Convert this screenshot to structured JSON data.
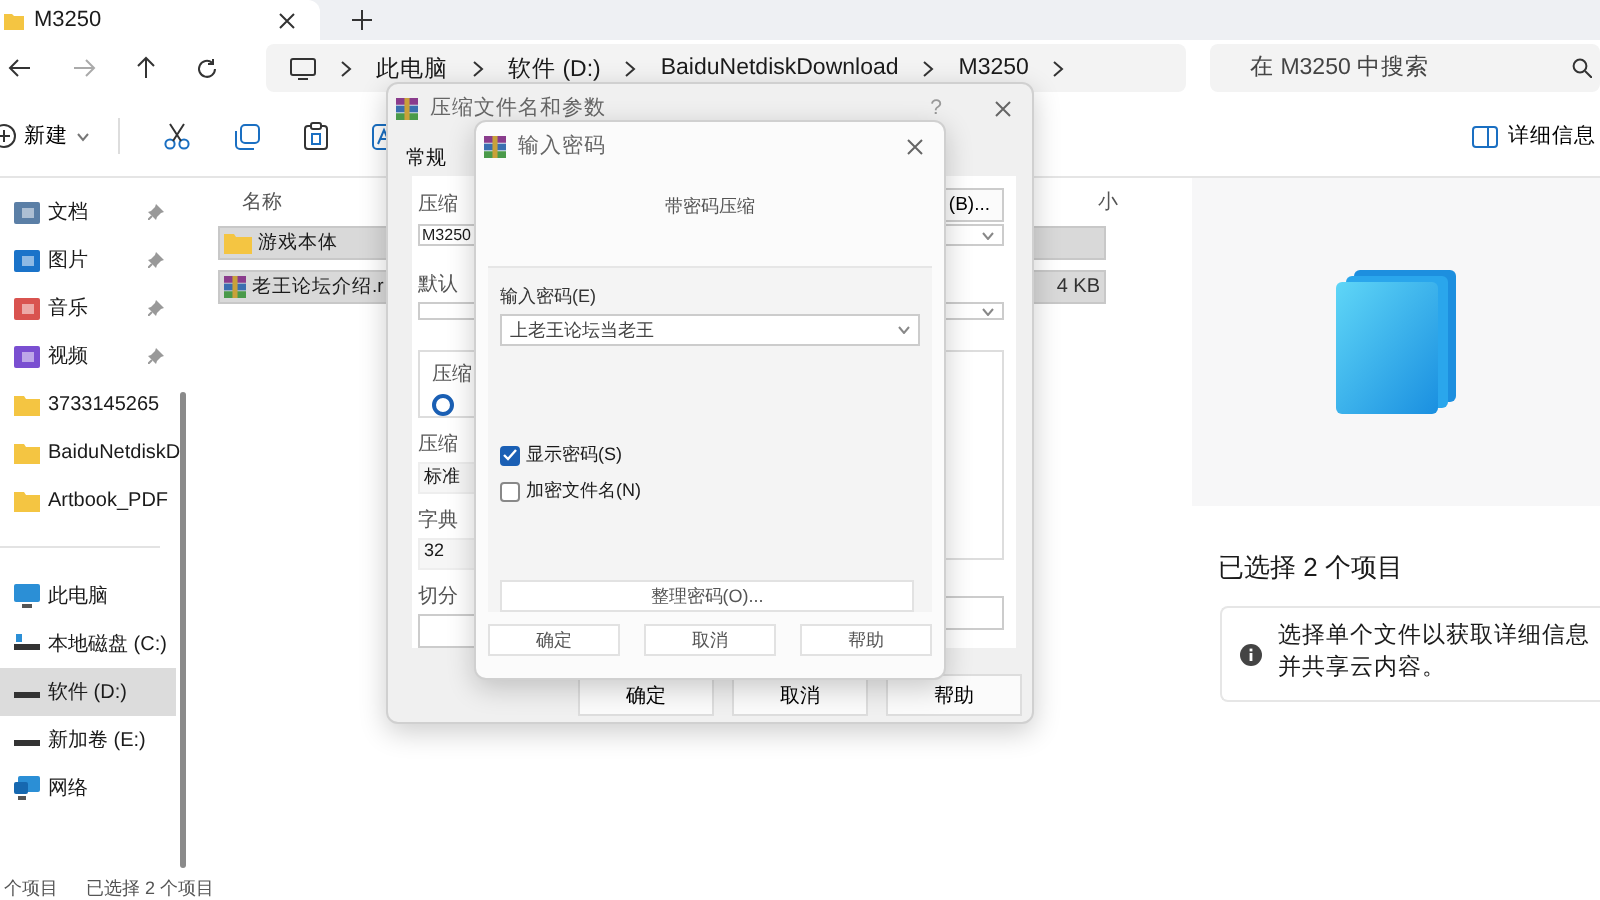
{
  "tabs": [
    {
      "label": "M3250",
      "selected": true
    }
  ],
  "nav": {
    "breadcrumb": [
      "此电脑",
      "软件 (D:)",
      "BaiduNetdiskDownload",
      "M3250"
    ],
    "search": {
      "placeholder": "在 M3250 中搜索"
    }
  },
  "toolbar": {
    "new_label": "新建",
    "details_label": "详细信息"
  },
  "sidebar": {
    "groups": [
      [
        {
          "label": "文档",
          "kind": "documents",
          "pinned": true,
          "selected": false
        },
        {
          "label": "图片",
          "kind": "pictures",
          "pinned": true,
          "selected": false
        },
        {
          "label": "音乐",
          "kind": "music",
          "pinned": true,
          "selected": false
        },
        {
          "label": "视频",
          "kind": "videos",
          "pinned": true,
          "selected": false
        },
        {
          "label": "3733145265",
          "kind": "folder",
          "pinned": false,
          "selected": false
        },
        {
          "label": "BaiduNetdiskD",
          "kind": "folder",
          "pinned": false,
          "selected": false
        },
        {
          "label": "Artbook_PDF",
          "kind": "folder",
          "pinned": false,
          "selected": false
        }
      ],
      [
        {
          "label": "此电脑",
          "kind": "pc",
          "pinned": false,
          "selected": false
        },
        {
          "label": "本地磁盘 (C:)",
          "kind": "system-drive",
          "pinned": false,
          "selected": false
        },
        {
          "label": "软件 (D:)",
          "kind": "drive",
          "pinned": false,
          "selected": true
        },
        {
          "label": "新加卷 (E:)",
          "kind": "drive",
          "pinned": false,
          "selected": false
        },
        {
          "label": "网络",
          "kind": "network",
          "pinned": false,
          "selected": false
        }
      ]
    ]
  },
  "file_list": {
    "columns": [
      "名称",
      "小"
    ],
    "rows": [
      {
        "name": "游戏本体",
        "kind": "folder",
        "selected": true
      },
      {
        "name": "老王论坛介绍.r",
        "kind": "archive",
        "size": "4 KB",
        "selected": true
      }
    ]
  },
  "details_pane": {
    "title": "已选择 2 个项目",
    "info": "选择单个文件以获取详细信息并共享云内容。"
  },
  "status_bar": [
    "个项目",
    "已选择 2 个项目"
  ],
  "archive_dialog": {
    "title": "压缩文件名和参数",
    "help": "?",
    "tabs": [
      {
        "label": "常规",
        "selected": true
      }
    ],
    "name_label": "压缩",
    "browse_button": "(B)...",
    "name_value": "M3250",
    "profile_label": "默认",
    "format_group": "压缩",
    "format_option": {
      "selected": true
    },
    "method_label": "压缩",
    "method_value": "标准",
    "dict_label": "字典",
    "dict_value": "32",
    "split_label": "切分",
    "buttons": [
      "确定",
      "取消",
      "帮助"
    ]
  },
  "password_dialog": {
    "title": "输入密码",
    "heading": "带密码压缩",
    "password_label": "输入密码(E)",
    "password_value": "上老王论坛当老王",
    "options": [
      {
        "label": "显示密码(S)",
        "checked": true
      },
      {
        "label": "加密文件名(N)",
        "checked": false
      }
    ],
    "organize_button": "整理密码(O)...",
    "buttons": [
      "确定",
      "取消",
      "帮助"
    ]
  }
}
